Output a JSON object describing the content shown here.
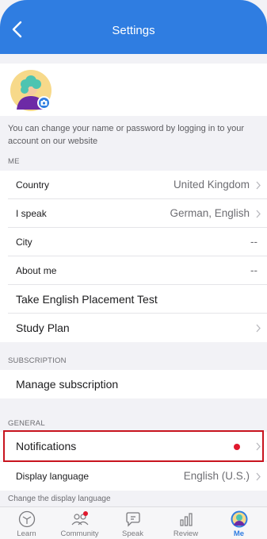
{
  "header": {
    "title": "Settings",
    "back_icon": "chevron-left-icon"
  },
  "profile": {
    "camera_icon": "camera-icon",
    "note": "You can change your name or password by logging in to your account on our website"
  },
  "sections": {
    "me": "ME",
    "subscription": "SUBSCRIPTION",
    "general": "GENERAL"
  },
  "me_rows": {
    "country": {
      "label": "Country",
      "value": "United Kingdom"
    },
    "speak": {
      "label": "I speak",
      "value": "German, English"
    },
    "city": {
      "label": "City",
      "value": "--"
    },
    "about": {
      "label": "About me",
      "value": "--"
    },
    "placement": {
      "label": "Take English Placement Test"
    },
    "study_plan": {
      "label": "Study Plan"
    }
  },
  "subscription_rows": {
    "manage": {
      "label": "Manage subscription"
    }
  },
  "general_rows": {
    "notifications": {
      "label": "Notifications"
    },
    "display_language": {
      "label": "Display language",
      "value": "English (U.S.)"
    }
  },
  "hint": "Change the display language",
  "tabs": [
    {
      "label": "Learn",
      "icon": "learn-icon"
    },
    {
      "label": "Community",
      "icon": "community-icon"
    },
    {
      "label": "Speak",
      "icon": "speak-icon"
    },
    {
      "label": "Review",
      "icon": "review-icon"
    },
    {
      "label": "Me",
      "icon": "me-avatar-icon"
    }
  ],
  "colors": {
    "accent": "#2f7de1",
    "highlight": "#c8141f",
    "notification_dot": "#e0182d"
  }
}
